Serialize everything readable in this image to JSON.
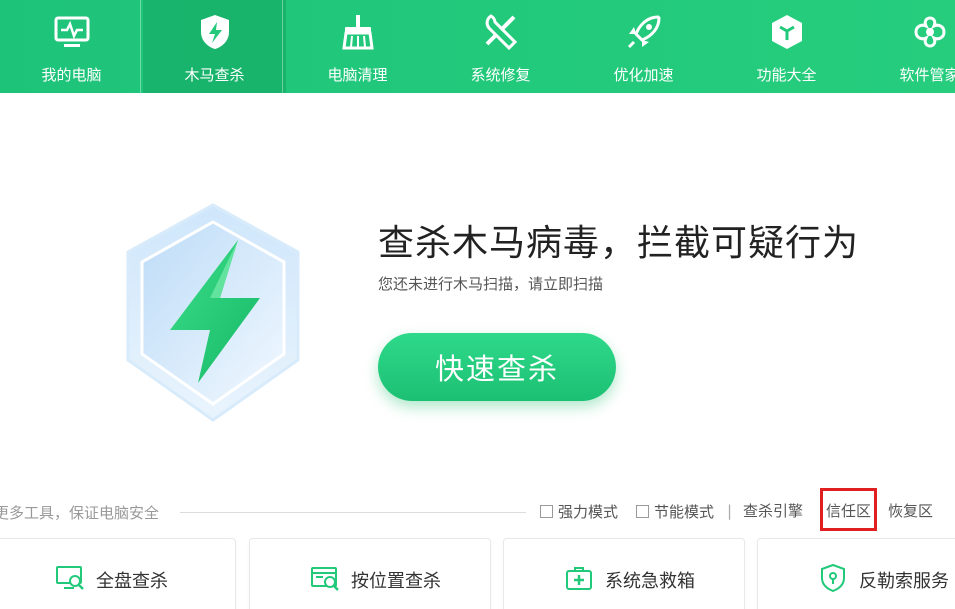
{
  "nav": {
    "items": [
      {
        "label": "我的电脑",
        "icon": "monitor-pulse-icon"
      },
      {
        "label": "木马查杀",
        "icon": "shield-lightning-icon",
        "active": true
      },
      {
        "label": "电脑清理",
        "icon": "broom-icon"
      },
      {
        "label": "系统修复",
        "icon": "wrench-screwdriver-icon"
      },
      {
        "label": "优化加速",
        "icon": "rocket-icon"
      },
      {
        "label": "功能大全",
        "icon": "hexagon-cube-icon"
      },
      {
        "label": "软件管家",
        "icon": "app-grid-icon"
      }
    ]
  },
  "hero": {
    "title": "查杀木马病毒，拦截可疑行为",
    "subtitle": "您还未进行木马扫描，请立即扫描",
    "button_label": "快速查杀"
  },
  "tools": {
    "caption": "更多工具，保证电脑安全",
    "modes": [
      {
        "label": "强力模式",
        "checked": false
      },
      {
        "label": "节能模式",
        "checked": false
      }
    ],
    "separator": "|",
    "links": [
      "查杀引擎",
      "信任区",
      "恢复区"
    ],
    "cards": [
      {
        "label": "全盘查杀",
        "icon": "monitor-search-icon"
      },
      {
        "label": "按位置查杀",
        "icon": "folder-search-icon"
      },
      {
        "label": "系统急救箱",
        "icon": "first-aid-kit-icon"
      },
      {
        "label": "反勒索服务",
        "icon": "shield-lock-icon"
      }
    ]
  },
  "colors": {
    "brand_green": "#22c97b",
    "highlight_red": "#e02020"
  }
}
